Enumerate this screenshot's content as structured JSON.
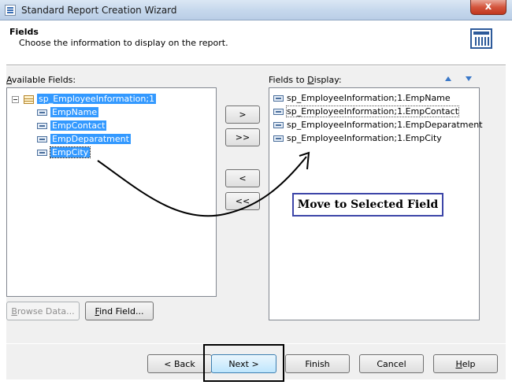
{
  "window": {
    "title": "Standard Report Creation Wizard",
    "close_label": "x"
  },
  "header": {
    "title": "Fields",
    "subtitle": "Choose the information to display on the report."
  },
  "available": {
    "label_prefix": "",
    "label_accel": "A",
    "label_rest": "vailable Fields:",
    "root": "sp_EmployeeInformation;1",
    "fields": [
      "EmpName",
      "EmpContact",
      "EmpDeparatment",
      "EmpCity"
    ]
  },
  "display": {
    "label_prefix": "Fields to ",
    "label_accel": "D",
    "label_rest": "isplay:",
    "fields": [
      "sp_EmployeeInformation;1.EmpName",
      "sp_EmployeeInformation;1.EmpContact",
      "sp_EmployeeInformation;1.EmpDeparatment",
      "sp_EmployeeInformation;1.EmpCity"
    ],
    "selected_index": 1
  },
  "move": {
    "add_one": ">",
    "add_all": ">>",
    "remove_one": "<",
    "remove_all": "<<"
  },
  "buttons": {
    "browse_accel": "B",
    "browse_prefix": "",
    "browse_rest": "rowse Data...",
    "find_accel": "F",
    "find_prefix": "",
    "find_rest": "ind Field...",
    "back": "< Back",
    "next": "Next >",
    "finish": "Finish",
    "cancel": "Cancel",
    "help_accel": "H",
    "help_rest": "elp"
  },
  "annotation": {
    "callout": "Move to Selected Field"
  }
}
